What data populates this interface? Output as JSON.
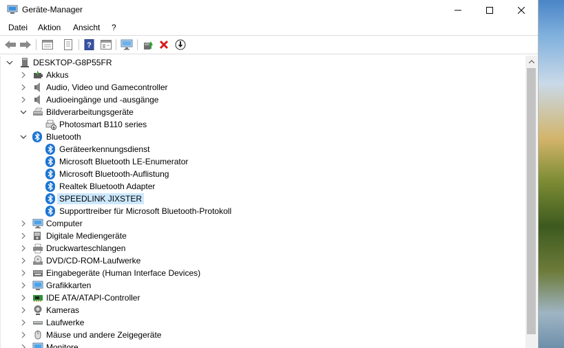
{
  "window": {
    "title": "Geräte-Manager"
  },
  "menu": [
    "Datei",
    "Aktion",
    "Ansicht",
    "?"
  ],
  "toolbar": {
    "buttons": [
      "back",
      "forward",
      "properties-sheet",
      "details",
      "help",
      "view-resources",
      "monitor",
      "update-driver",
      "uninstall",
      "download"
    ]
  },
  "tree": {
    "root": "DESKTOP-G8P55FR",
    "nodes": [
      {
        "label": "Akkus",
        "icon": "battery-icon",
        "expanded": false
      },
      {
        "label": "Audio, Video und Gamecontroller",
        "icon": "speaker-icon",
        "expanded": false
      },
      {
        "label": "Audioeingänge und -ausgänge",
        "icon": "speaker-icon",
        "expanded": false
      },
      {
        "label": "Bildverarbeitungsgeräte",
        "icon": "scanner-icon",
        "expanded": true,
        "children": [
          "Photosmart B110 series"
        ]
      },
      {
        "label": "Bluetooth",
        "icon": "bluetooth-icon",
        "expanded": true,
        "children": [
          "Geräteerkennungsdienst",
          "Microsoft Bluetooth LE-Enumerator",
          "Microsoft Bluetooth-Auflistung",
          "Realtek Bluetooth Adapter",
          "SPEEDLINK JIXSTER",
          "Supporttreiber für Microsoft Bluetooth-Protokoll"
        ]
      },
      {
        "label": "Computer",
        "icon": "computer-icon",
        "expanded": false
      },
      {
        "label": "Digitale Mediengeräte",
        "icon": "media-icon",
        "expanded": false
      },
      {
        "label": "Druckwarteschlangen",
        "icon": "printer-icon",
        "expanded": false
      },
      {
        "label": "DVD/CD-ROM-Laufwerke",
        "icon": "disc-icon",
        "expanded": false
      },
      {
        "label": "Eingabegeräte (Human Interface Devices)",
        "icon": "keyboard-icon",
        "expanded": false
      },
      {
        "label": "Grafikkarten",
        "icon": "display-icon",
        "expanded": false
      },
      {
        "label": "IDE ATA/ATAPI-Controller",
        "icon": "controller-icon",
        "expanded": false
      },
      {
        "label": "Kameras",
        "icon": "camera-icon",
        "expanded": false
      },
      {
        "label": "Laufwerke",
        "icon": "drive-icon",
        "expanded": false
      },
      {
        "label": "Mäuse und andere Zeigegeräte",
        "icon": "mouse-icon",
        "expanded": false
      },
      {
        "label": "Monitore",
        "icon": "monitor-icon",
        "expanded": false
      }
    ],
    "selected": "SPEEDLINK JIXSTER"
  },
  "colors": {
    "selection": "#cce8ff",
    "bluetooth": "#1c75d2",
    "scroll_thumb": "#c2c2c2"
  }
}
